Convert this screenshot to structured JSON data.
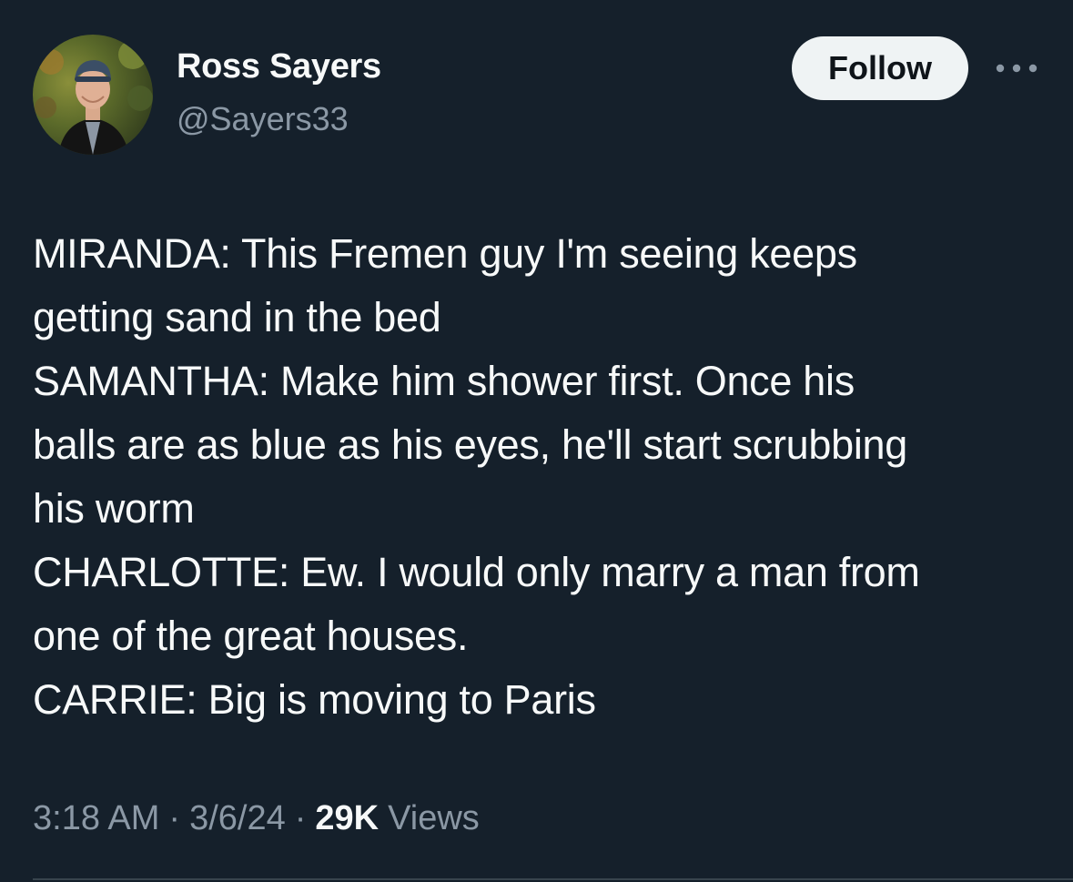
{
  "author": {
    "display_name": "Ross Sayers",
    "handle": "@Sayers33",
    "avatar_icon": "profile-photo"
  },
  "actions": {
    "follow_label": "Follow",
    "more_icon": "more-horizontal-icon"
  },
  "tweet": {
    "lines": [
      "MIRANDA: This Fremen guy I'm seeing keeps",
      "getting sand in the bed",
      "SAMANTHA: Make him shower first. Once his",
      "balls are as blue as his eyes, he'll start scrubbing",
      "his worm",
      "CHARLOTTE: Ew. I would only marry a man from",
      "one of the great houses.",
      "CARRIE: Big is moving to Paris"
    ]
  },
  "meta": {
    "time": "3:18 AM",
    "separator": "·",
    "date": "3/6/24",
    "views_count": "29K",
    "views_label": "Views"
  },
  "colors": {
    "background": "#15202b",
    "text_primary": "#f7f9f9",
    "text_secondary": "#8b98a5",
    "follow_button_bg": "#eff3f4",
    "divider": "#38444d"
  }
}
